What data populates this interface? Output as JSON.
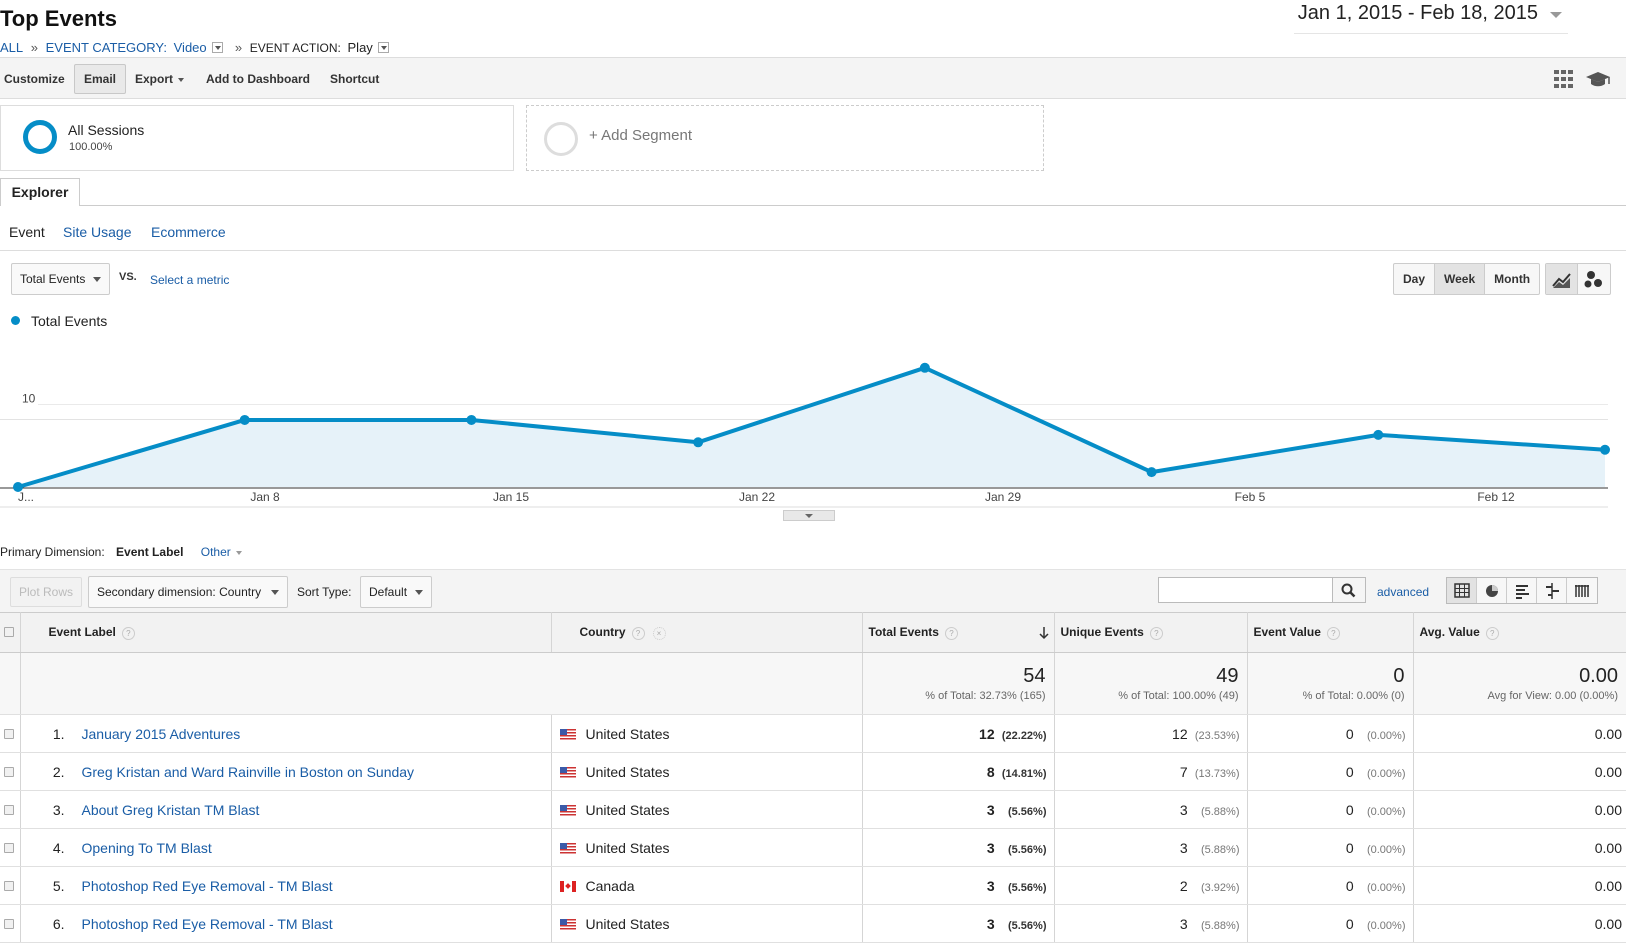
{
  "header": {
    "title": "Top Events",
    "crumb_all": "ALL",
    "crumb_sep": "»",
    "crumb_category_label": "EVENT CATEGORY:",
    "crumb_category_value": "Video",
    "crumb_action_label": "EVENT ACTION:",
    "crumb_action_value": "Play",
    "date_start": "Jan 1, 2015",
    "date_sep": "-",
    "date_end": "Feb 18, 2015"
  },
  "toolbar": {
    "customize": "Customize",
    "email": "Email",
    "export": "Export",
    "add_to_dashboard": "Add to Dashboard",
    "shortcut": "Shortcut"
  },
  "segments": {
    "all_name": "All Sessions",
    "all_pct": "100.00%",
    "add_label": "+ Add Segment"
  },
  "explorer": {
    "tab": "Explorer",
    "subtabs": [
      "Event",
      "Site Usage",
      "Ecommerce"
    ],
    "metric": "Total Events",
    "vs": "VS.",
    "select_metric": "Select a metric",
    "granularity": [
      "Day",
      "Week",
      "Month"
    ],
    "active_granularity": "Week"
  },
  "chart_data": {
    "type": "area",
    "series": [
      {
        "name": "Total Events",
        "values": [
          0,
          9,
          9,
          6,
          16,
          2,
          7,
          5
        ]
      }
    ],
    "x_tick_labels": [
      "J...",
      "Jan 8",
      "Jan 15",
      "Jan 22",
      "Jan 29",
      "Feb 5",
      "Feb 12"
    ],
    "y_ticks": [
      "20",
      "10"
    ],
    "ylim": [
      0,
      20
    ],
    "grid": true,
    "legend": "top-left",
    "color": "#058dc7"
  },
  "table_controls": {
    "primary_dimension_label": "Primary Dimension:",
    "primary_dimension_value": "Event Label",
    "other": "Other",
    "plot_rows": "Plot Rows",
    "secondary_dimension": "Secondary dimension: Country",
    "sort_type_label": "Sort Type:",
    "sort_type_value": "Default",
    "search_placeholder": "",
    "advanced": "advanced"
  },
  "table": {
    "headers": [
      "Event Label",
      "Country",
      "Total Events",
      "Unique Events",
      "Event Value",
      "Avg. Value"
    ],
    "totals": {
      "total_events": "54",
      "total_events_sub": "% of Total: 32.73% (165)",
      "unique_events": "49",
      "unique_events_sub": "% of Total: 100.00% (49)",
      "event_value": "0",
      "event_value_sub": "% of Total: 0.00% (0)",
      "avg_value": "0.00",
      "avg_value_sub": "Avg for View: 0.00 (0.00%)"
    },
    "rows": [
      {
        "idx": "1.",
        "label": "January 2015 Adventures",
        "country": "United States",
        "flag": "us",
        "total": "12",
        "total_pct": "(22.22%)",
        "unique": "12",
        "unique_pct": "(23.53%)",
        "value": "0",
        "value_pct": "(0.00%)",
        "avg": "0.00"
      },
      {
        "idx": "2.",
        "label": "Greg Kristan and Ward Rainville in Boston on Sunday",
        "country": "United States",
        "flag": "us",
        "total": "8",
        "total_pct": "(14.81%)",
        "unique": "7",
        "unique_pct": "(13.73%)",
        "value": "0",
        "value_pct": "(0.00%)",
        "avg": "0.00"
      },
      {
        "idx": "3.",
        "label": "About Greg Kristan TM Blast",
        "country": "United States",
        "flag": "us",
        "total": "3",
        "total_pct": "(5.56%)",
        "unique": "3",
        "unique_pct": "(5.88%)",
        "value": "0",
        "value_pct": "(0.00%)",
        "avg": "0.00"
      },
      {
        "idx": "4.",
        "label": "Opening To TM Blast",
        "country": "United States",
        "flag": "us",
        "total": "3",
        "total_pct": "(5.56%)",
        "unique": "3",
        "unique_pct": "(5.88%)",
        "value": "0",
        "value_pct": "(0.00%)",
        "avg": "0.00"
      },
      {
        "idx": "5.",
        "label": "Photoshop Red Eye Removal - TM Blast",
        "country": "Canada",
        "flag": "ca",
        "total": "3",
        "total_pct": "(5.56%)",
        "unique": "2",
        "unique_pct": "(3.92%)",
        "value": "0",
        "value_pct": "(0.00%)",
        "avg": "0.00"
      },
      {
        "idx": "6.",
        "label": "Photoshop Red Eye Removal - TM Blast",
        "country": "United States",
        "flag": "us",
        "total": "3",
        "total_pct": "(5.56%)",
        "unique": "3",
        "unique_pct": "(5.88%)",
        "value": "0",
        "value_pct": "(0.00%)",
        "avg": "0.00"
      }
    ]
  }
}
